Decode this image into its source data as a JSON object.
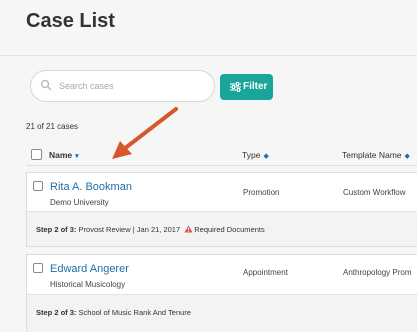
{
  "header": {
    "title": "Case List"
  },
  "toolbar": {
    "search_placeholder": "Search cases",
    "search_value": "",
    "filter_label": "Filter"
  },
  "summary": {
    "count_text": "21 of 21 cases"
  },
  "table": {
    "columns": [
      {
        "label": "Name",
        "sort_icon": "▾"
      },
      {
        "label": "Type",
        "sort_icon": "◆"
      },
      {
        "label": "Template Name",
        "sort_icon": "◆"
      }
    ],
    "rows": [
      {
        "name": "Rita A. Bookman",
        "dept": "Demo University",
        "type": "Promotion",
        "template": "Custom Workflow",
        "step_prefix": "Step 2 of 3:",
        "step_text": "Provost Review",
        "step_sep": "|",
        "step_date": "Jan 21, 2017",
        "step_warning": "Required Documents"
      },
      {
        "name": "Edward Angerer",
        "dept": "Historical Musicology",
        "type": "Appointment",
        "template": "Anthropology Prom",
        "step_prefix": "Step 2 of 3:",
        "step_text": "School of Music Rank And Tenure"
      }
    ]
  },
  "colors": {
    "accent": "#1aa59b",
    "link": "#1f6fa8",
    "warning": "#d9534f",
    "annotation": "#d4582b"
  },
  "icons": {
    "search": "search-icon",
    "filter": "filter-icon",
    "warning": "warning-icon",
    "arrow": "annotation-arrow"
  }
}
